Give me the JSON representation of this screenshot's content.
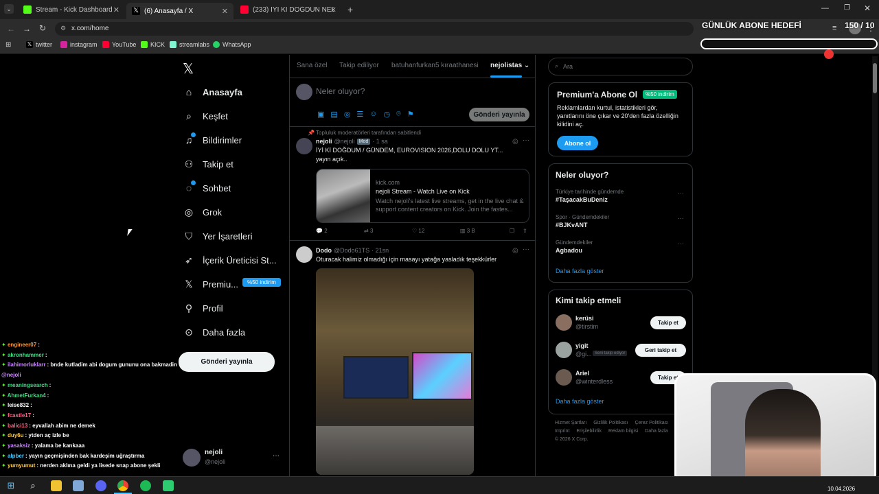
{
  "browser": {
    "tabs": [
      {
        "title": "Stream - Kick Dashboard",
        "icon": "kick-icon",
        "color": "#53fc18"
      },
      {
        "title": "(6) Anasayfa / X",
        "icon": "x-logo-icon",
        "color": "#ffffff"
      },
      {
        "title": "(233) İYİ Kİ DOĞDUN NECO! - Y",
        "icon": "youtube-icon",
        "color": "#ff0033"
      }
    ],
    "new_tab": "+",
    "url": "x.com/home",
    "bookmarks": [
      "twitter",
      "instagram",
      "YouTube",
      "KICK",
      "streamlabs",
      "WhatsApp"
    ]
  },
  "overlay": {
    "goal_title": "GÜNLÜK ABONE HEDEFİ",
    "goal_count": "150 / 10",
    "goal_progress": 0.0
  },
  "x_nav": {
    "items": [
      {
        "label": "Anasayfa",
        "icon": "home-icon"
      },
      {
        "label": "Keşfet",
        "icon": "search-icon"
      },
      {
        "label": "Bildirimler",
        "icon": "bell-icon"
      },
      {
        "label": "Takip et",
        "icon": "add-person-icon"
      },
      {
        "label": "Sohbet",
        "icon": "chat-icon"
      },
      {
        "label": "Grok",
        "icon": "grok-icon"
      },
      {
        "label": "Yer İşaretleri",
        "icon": "bookmark-icon"
      },
      {
        "label": "İçerik Üreticisi St...",
        "icon": "rocket-icon"
      },
      {
        "label": "Premiu...",
        "icon": "x-logo-icon"
      },
      {
        "label": "Profil",
        "icon": "person-icon"
      },
      {
        "label": "Daha fazla",
        "icon": "more-circle-icon"
      }
    ],
    "premium_badge": "%50 indirim",
    "post_button": "Gönderi yayınla",
    "account_name": "nejoli",
    "account_handle": "@nejoli",
    "account_more": "···"
  },
  "feed": {
    "tabs": [
      "Sana özel",
      "Takip ediliyor",
      "batuhanfurkan5 kıraathanesi",
      "nejolistas"
    ],
    "compose_placeholder": "Neler oluyor?",
    "compose_button": "Gönderi yayınla",
    "posts": [
      {
        "pinned": "Topluluk moderatörleri tarafından sabitlendi",
        "name": "nejoli",
        "handle": "@nejoli",
        "badge": "Mod",
        "time": "· 1 sa",
        "text1": "İYİ Kİ DOĞDUM / GÜNDEM, EUROVISION 2026,DOLU DOLU YT...",
        "text2": "yayın açık..",
        "card_domain": "kick.com",
        "card_title": "nejoli Stream - Watch Live on Kick",
        "card_desc": "Watch nejoli's latest live streams, get in the live chat & support content creators on Kick. Join the fastes...",
        "replies": "2",
        "reposts": "3",
        "likes": "12",
        "views": "3 B"
      },
      {
        "name": "Dodo",
        "handle": "@Dodo61TS",
        "time": "· 21sn",
        "text1": "Oturacak halimiz olmadığı için masayı yatağa yasladık teşekkürler"
      }
    ]
  },
  "right": {
    "search_placeholder": "Ara",
    "premium_title": "Premium'a Abone Ol",
    "premium_badge": "%50 indirim",
    "premium_text": "Reklamlardan kurtul, istatistikleri gör, yanıtlarını öne çıkar ve 20'den fazla özelliğin kilidini aç.",
    "premium_button": "Abone ol",
    "trends_title": "Neler oluyor?",
    "trends": [
      {
        "category": "Türkiye tarihinde gündemde",
        "name": "#TaşacakBuDeniz"
      },
      {
        "category": "Spor · Gündemdekiler",
        "name": "#BJKvANT"
      },
      {
        "category": "Gündemdekiler",
        "name": "Agbadou"
      }
    ],
    "show_more": "Daha fazla göster",
    "who_title": "Kimi takip etmeli",
    "who": [
      {
        "name": "kerüsi",
        "handle": "@tirstim",
        "button": "Takip et",
        "tag": ""
      },
      {
        "name": "yigit",
        "handle": "@gi...",
        "button": "Geri takip et",
        "tag": "Seni takip ediyor"
      },
      {
        "name": "Ariel",
        "handle": "@winterdless",
        "button": "Takip et",
        "tag": ""
      }
    ],
    "who_more": "Daha fazla göster",
    "footer1": [
      "Hizmet Şartları",
      "Gizlilik Politikası",
      "Çerez Politikası"
    ],
    "footer2": [
      "Imprint",
      "Erişilebilirlik",
      "Reklam bilgisi",
      "Daha fazla"
    ],
    "copyright": "© 2026 X Corp."
  },
  "chat": [
    {
      "user": "engineer07",
      "msg": ":",
      "color": "#ff9933"
    },
    {
      "user": "akronhammer",
      "msg": ":",
      "color": "#44dd88"
    },
    {
      "user": "ilahimorluklarr",
      "msg": ": bnde kutladim abi dogum gununu ona bakmadin",
      "color": "#cc88ff"
    },
    {
      "user": "@nejoli",
      "msg": "",
      "color": "#cc88ff"
    },
    {
      "user": "meaningsearch",
      "msg": ":",
      "color": "#44dd88"
    },
    {
      "user": "AhmetFurkan4",
      "msg": ":",
      "color": "#44dd88"
    },
    {
      "user": "leise832",
      "msg": ":",
      "color": "#ffffff"
    },
    {
      "user": "fcastle17",
      "msg": ":",
      "color": "#ff6688"
    },
    {
      "user": "balici13",
      "msg": ": eyvallah abim ne demek",
      "color": "#ff6688"
    },
    {
      "user": "duy6u",
      "msg": ": ytden aç izle be",
      "color": "#ffcc44"
    },
    {
      "user": "yasaksiz",
      "msg": ": yalama be kankaaa",
      "color": "#cc88ff"
    },
    {
      "user": "alpber",
      "msg": ": yayın geçmişinden bak kardeşim uğraştırma",
      "color": "#44ccff"
    },
    {
      "user": "yumyumut",
      "msg": ": nerden aklına geldi ya lisede snap abone şekli",
      "color": "#ffcc44"
    }
  ],
  "taskbar": {
    "date": "10.04.2026"
  }
}
